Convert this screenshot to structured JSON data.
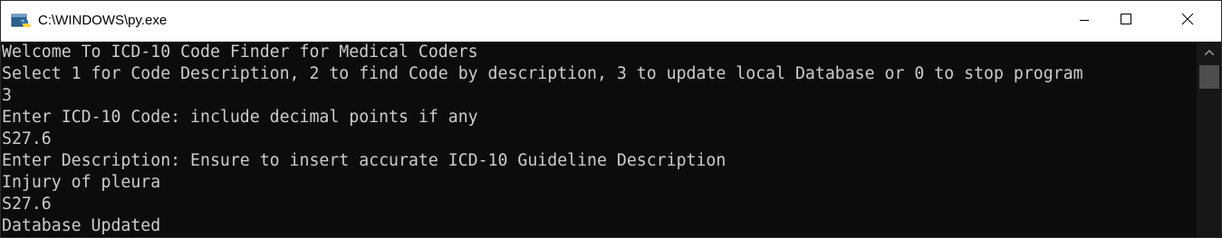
{
  "window": {
    "title": "C:\\WINDOWS\\py.exe"
  },
  "icons": {
    "app": "python-console-icon",
    "minimize": "minimize-icon",
    "maximize": "maximize-icon",
    "close": "close-icon",
    "scroll_up": "scroll-up-arrow-icon"
  },
  "colors": {
    "console_bg": "#0c0c0c",
    "console_text": "#cccccc",
    "titlebar_bg": "#ffffff"
  },
  "console": {
    "lines": [
      "Welcome To ICD-10 Code Finder for Medical Coders",
      "Select 1 for Code Description, 2 to find Code by description, 3 to update local Database or 0 to stop program",
      "3",
      "Enter ICD-10 Code: include decimal points if any",
      "S27.6",
      "Enter Description: Ensure to insert accurate ICD-10 Guideline Description",
      "Injury of pleura",
      "S27.6",
      "Database Updated"
    ]
  }
}
